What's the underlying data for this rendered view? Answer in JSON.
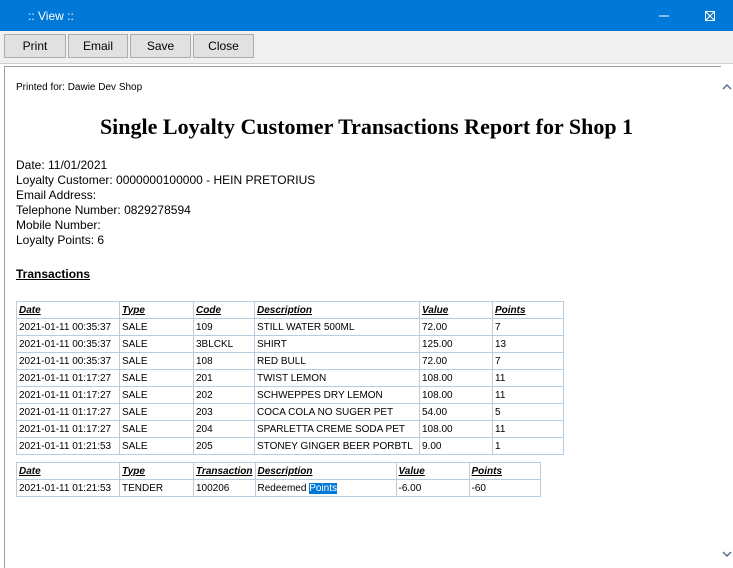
{
  "window": {
    "title": ":: View ::"
  },
  "toolbar": {
    "print": "Print",
    "email": "Email",
    "save": "Save",
    "close": "Close"
  },
  "report": {
    "printed_for": "Printed for: Dawie Dev Shop",
    "title": "Single Loyalty Customer Transactions Report for Shop 1",
    "date": "Date: 11/01/2021",
    "customer": "Loyalty Customer: 0000000100000 - HEIN PRETORIUS",
    "email": "Email Address:",
    "telephone": "Telephone Number: 0829278594",
    "mobile": "Mobile Number:",
    "points": "Loyalty Points: 6",
    "section": "Transactions"
  },
  "sales_table": {
    "headers": [
      "Date",
      "Type",
      "Code",
      "Description",
      "Value",
      "Points"
    ],
    "rows": [
      [
        "2021-01-11 00:35:37",
        "SALE",
        "109",
        "STILL WATER 500ML",
        "72.00",
        "7"
      ],
      [
        "2021-01-11 00:35:37",
        "SALE",
        "3BLCKL",
        "SHIRT",
        "125.00",
        "13"
      ],
      [
        "2021-01-11 00:35:37",
        "SALE",
        "108",
        "RED BULL",
        "72.00",
        "7"
      ],
      [
        "2021-01-11 01:17:27",
        "SALE",
        "201",
        "TWIST LEMON",
        "108.00",
        "11"
      ],
      [
        "2021-01-11 01:17:27",
        "SALE",
        "202",
        "SCHWEPPES DRY LEMON",
        "108.00",
        "11"
      ],
      [
        "2021-01-11 01:17:27",
        "SALE",
        "203",
        "COCA COLA NO SUGER PET",
        "54.00",
        "5"
      ],
      [
        "2021-01-11 01:17:27",
        "SALE",
        "204",
        "SPARLETTA CREME SODA PET",
        "108.00",
        "11"
      ],
      [
        "2021-01-11 01:21:53",
        "SALE",
        "205",
        "STONEY GINGER BEER PORBTL",
        "9.00",
        "1"
      ]
    ]
  },
  "tender_table": {
    "headers": [
      "Date",
      "Type",
      "Transaction",
      "Description",
      "Value",
      "Points"
    ],
    "row": {
      "date": "2021-01-11 01:21:53",
      "type": "TENDER",
      "transaction": "100206",
      "description_prefix": "Redeemed",
      "description_highlight": "Points",
      "value": "-6.00",
      "points": "-60"
    }
  },
  "icons": {
    "minimize": "minimize-icon",
    "maximize": "maximize-icon",
    "close": "close-icon",
    "scroll_up": "chevron-up-icon",
    "scroll_down": "chevron-down-icon"
  }
}
